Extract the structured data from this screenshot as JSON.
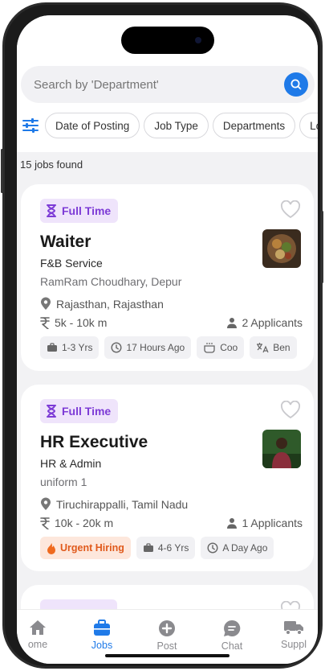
{
  "search": {
    "placeholder": "Search by 'Department'"
  },
  "filters": [
    "Date of Posting",
    "Job Type",
    "Departments",
    "Lo"
  ],
  "results_label": "15 jobs found",
  "jobs": [
    {
      "type": "Full Time",
      "title": "Waiter",
      "department": "F&B Service",
      "company": "RamRam Choudhary, Depur",
      "location": "Rajasthan, Rajasthan",
      "salary": "5k - 10k m",
      "applicants": "2 Applicants",
      "tags": [
        "1-3 Yrs",
        "17 Hours Ago",
        "Coo",
        "Ben"
      ]
    },
    {
      "type": "Full Time",
      "title": "HR Executive",
      "department": "HR & Admin",
      "company": "uniform 1",
      "location": "Tiruchirappalli, Tamil Nadu",
      "salary": "10k - 20k m",
      "applicants": "1 Applicants",
      "tags": [
        "Urgent Hiring",
        "4-6 Yrs",
        "A Day Ago"
      ]
    }
  ],
  "bottom_nav": [
    "ome",
    "Jobs",
    "Post",
    "Chat",
    "Suppl"
  ],
  "colors": {
    "accent": "#1f7ae8",
    "badge": "#7d3bd6",
    "urgent": "#e05a1c"
  }
}
